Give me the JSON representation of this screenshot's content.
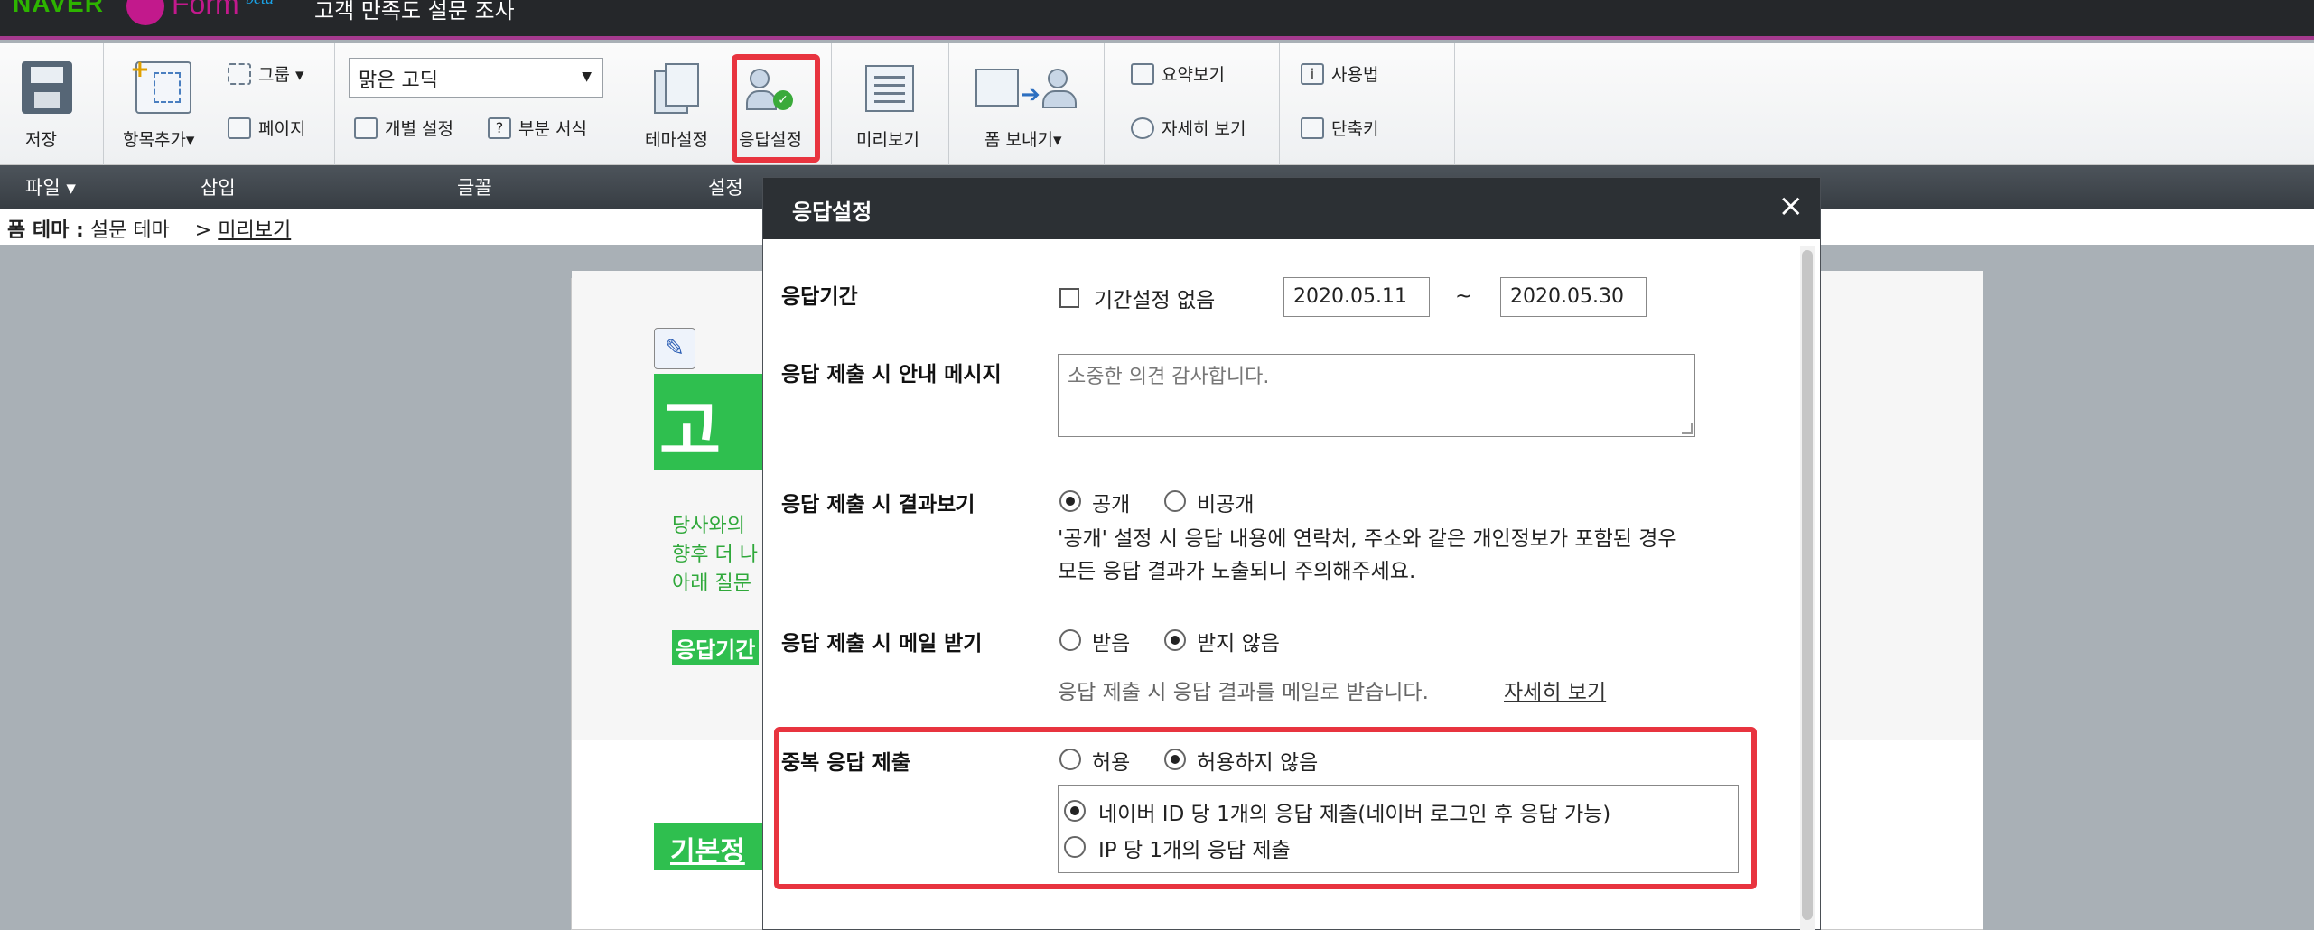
{
  "header": {
    "brand": "NAVER",
    "product": "Form",
    "beta": "beta",
    "doc_title": "고객 만족도 설문 조사"
  },
  "ribbon": {
    "save": "저장",
    "add_item": "항목추가▾",
    "group": "그룹 ▾",
    "page": "페이지",
    "font_value": "맑은 고딕",
    "individual_setting": "개별 설정",
    "partial_format": "부분 서식",
    "theme_setting": "테마설정",
    "response_setting": "응답설정",
    "preview": "미리보기",
    "send_form": "폼 보내기▾",
    "summary_view": "요약보기",
    "detail_view": "자세히 보기",
    "usage": "사용법",
    "shortcut": "단축키"
  },
  "group_labels": {
    "file": "파일 ▾",
    "insert": "삽입",
    "font": "글꼴",
    "settings": "설정"
  },
  "breadcrumb": {
    "theme_label": "폼 테마 :",
    "theme_value": "설문 테마",
    "sep": ">",
    "preview_link": "미리보기"
  },
  "preview": {
    "title_fragment": "고객",
    "line1": "당사와의",
    "line2": "향후 더 나",
    "line3": "아래 질문",
    "period_label": "응답기간",
    "basic_info": "기본정"
  },
  "modal": {
    "title": "응답설정",
    "close": "×",
    "period": {
      "label": "응답기간",
      "no_period_label": "기간설정 없음",
      "no_period_checked": false,
      "start": "2020.05.11",
      "tilde": "~",
      "end": "2020.05.30"
    },
    "message": {
      "label": "응답 제출 시 안내 메시지",
      "value": "소중한 의견 감사합니다."
    },
    "result_view": {
      "label": "응답 제출 시 결과보기",
      "opt_public": "공개",
      "opt_private": "비공개",
      "selected": "공개",
      "note1": "'공개' 설정 시 응답 내용에 연락처, 주소와 같은 개인정보가 포함된 경우",
      "note2": "모든 응답 결과가 노출되니 주의해주세요."
    },
    "mail": {
      "label": "응답 제출 시 메일 받기",
      "opt_receive": "받음",
      "opt_not": "받지 않음",
      "selected": "받지 않음",
      "desc": "응답 제출 시 응답 결과를 메일로 받습니다.",
      "more_link": "자세히 보기"
    },
    "duplicate": {
      "label": "중복 응답 제출",
      "opt_allow": "허용",
      "opt_deny": "허용하지 않음",
      "selected": "허용하지 않음",
      "sub_naver": "네이버 ID 당 1개의 응답 제출(네이버 로그인 후 응답 가능)",
      "sub_ip": "IP 당 1개의 응답 제출",
      "sub_selected": "naver"
    }
  },
  "colors": {
    "accent_red": "#e8343f",
    "green": "#2fbf4f",
    "naver_green": "#2db400",
    "form_magenta": "#c2198c"
  }
}
